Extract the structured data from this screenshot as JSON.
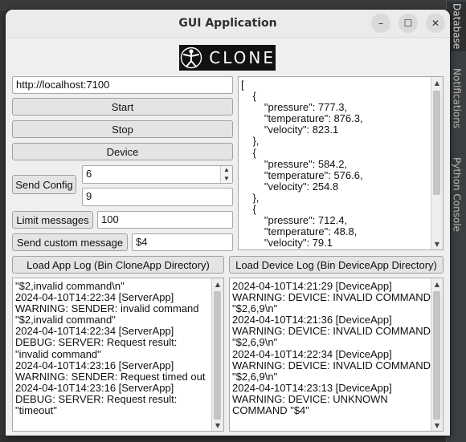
{
  "window": {
    "title": "GUI Application"
  },
  "logo": {
    "text": "CLONE"
  },
  "side_panel": {
    "tabs": [
      {
        "label": "Database",
        "icon": "database-icon"
      },
      {
        "label": "Notifications",
        "icon": "bell-icon"
      },
      {
        "label": "Python Console",
        "icon": "python-icon"
      }
    ]
  },
  "controls": {
    "url": "http://localhost:7100",
    "start_label": "Start",
    "stop_label": "Stop",
    "device_label": "Device",
    "send_config_label": "Send Config",
    "config_value_1": "6",
    "config_value_2": "9",
    "limit_messages_label": "Limit messages",
    "limit_messages_value": "100",
    "send_custom_label": "Send custom message",
    "custom_message_value": "$4"
  },
  "data_view": {
    "text": "[\n    {\n        \"pressure\": 777.3,\n        \"temperature\": 876.3,\n        \"velocity\": 823.1\n    },\n    {\n        \"pressure\": 584.2,\n        \"temperature\": 576.6,\n        \"velocity\": 254.8\n    },\n    {\n        \"pressure\": 712.4,\n        \"temperature\": 48.8,\n        \"velocity\": 79.1\n    }"
  },
  "app_log": {
    "button_label": "Load App Log (Bin CloneApp Directory)",
    "text": "\"$2,invalid command\\n\"\n2024-04-10T14:22:34 [ServerApp]\nWARNING: SENDER: invalid command\n\"$2,invalid command\"\n2024-04-10T14:22:34 [ServerApp]\nDEBUG: SERVER: Request result:\n\"invalid command\"\n2024-04-10T14:23:16 [ServerApp]\nWARNING: SENDER: Request timed out\n2024-04-10T14:23:16 [ServerApp]\nDEBUG: SERVER: Request result:\n\"timeout\""
  },
  "device_log": {
    "button_label": "Load Device Log (Bin DeviceApp Directory)",
    "text": "2024-04-10T14:21:29 [DeviceApp]\nWARNING: DEVICE: INVALID COMMAND\n\"$2,6,9\\n\"\n2024-04-10T14:21:36 [DeviceApp]\nWARNING: DEVICE: INVALID COMMAND\n\"$2,6,9\\n\"\n2024-04-10T14:22:34 [DeviceApp]\nWARNING: DEVICE: INVALID COMMAND\n\"$2,6,9\\n\"\n2024-04-10T14:23:13 [DeviceApp]\nWARNING: DEVICE: UNKNOWN\nCOMMAND \"$4\""
  }
}
